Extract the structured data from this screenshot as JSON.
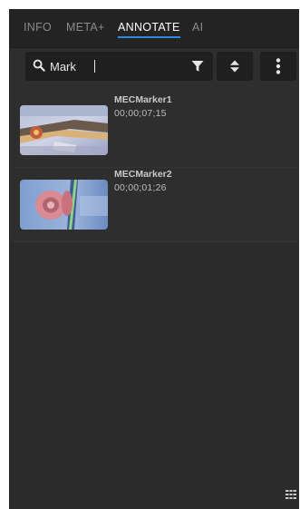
{
  "tabs": [
    {
      "label": "INFO",
      "active": false
    },
    {
      "label": "META+",
      "active": false
    },
    {
      "label": "ANNOTATE",
      "active": true
    },
    {
      "label": "AI",
      "active": false
    }
  ],
  "search": {
    "value": "Mark",
    "icon": "search-icon",
    "filter_icon": "filter-icon"
  },
  "toolbar": {
    "sort_icon": "sort-icon",
    "more_icon": "more-vertical-icon"
  },
  "markers": [
    {
      "name": "MECMarker1",
      "timecode": "00;00;07;15"
    },
    {
      "name": "MECMarker2",
      "timecode": "00;00;01;26"
    }
  ],
  "footer": {
    "view_icon": "grid-view-icon"
  },
  "colors": {
    "accent": "#2f8ae6",
    "panel_bg": "#2b2b2b",
    "tab_bg": "#232323",
    "field_bg": "#1f1f1f"
  }
}
